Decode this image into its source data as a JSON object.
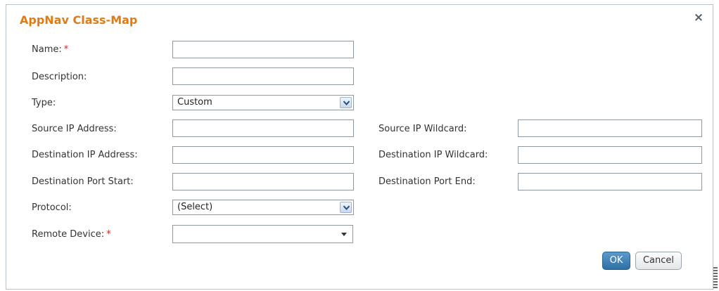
{
  "dialog": {
    "title": "AppNav Class-Map",
    "close_glyph": "×"
  },
  "form": {
    "name": {
      "label": "Name:",
      "required_mark": "*",
      "value": ""
    },
    "description": {
      "label": "Description:",
      "value": ""
    },
    "type": {
      "label": "Type:",
      "selected": "Custom"
    },
    "source_ip_address": {
      "label": "Source IP Address:",
      "value": ""
    },
    "source_ip_wildcard": {
      "label": "Source IP Wildcard:",
      "value": ""
    },
    "destination_ip_address": {
      "label": "Destination IP Address:",
      "value": ""
    },
    "destination_ip_wildcard": {
      "label": "Destination IP Wildcard:",
      "value": ""
    },
    "destination_port_start": {
      "label": "Destination Port Start:",
      "value": ""
    },
    "destination_port_end": {
      "label": "Destination Port End:",
      "value": ""
    },
    "protocol": {
      "label": "Protocol:",
      "selected": "(Select)"
    },
    "remote_device": {
      "label": "Remote Device:",
      "required_mark": "*",
      "selected": ""
    }
  },
  "buttons": {
    "ok": "OK",
    "cancel": "Cancel"
  },
  "icons": {
    "close": "close-icon",
    "dropdown": "chevron-down-icon",
    "combo_caret": "caret-down-icon"
  },
  "colors": {
    "title": "#e07b14",
    "required": "#d62020",
    "ok_button": "#2f6fa4"
  }
}
